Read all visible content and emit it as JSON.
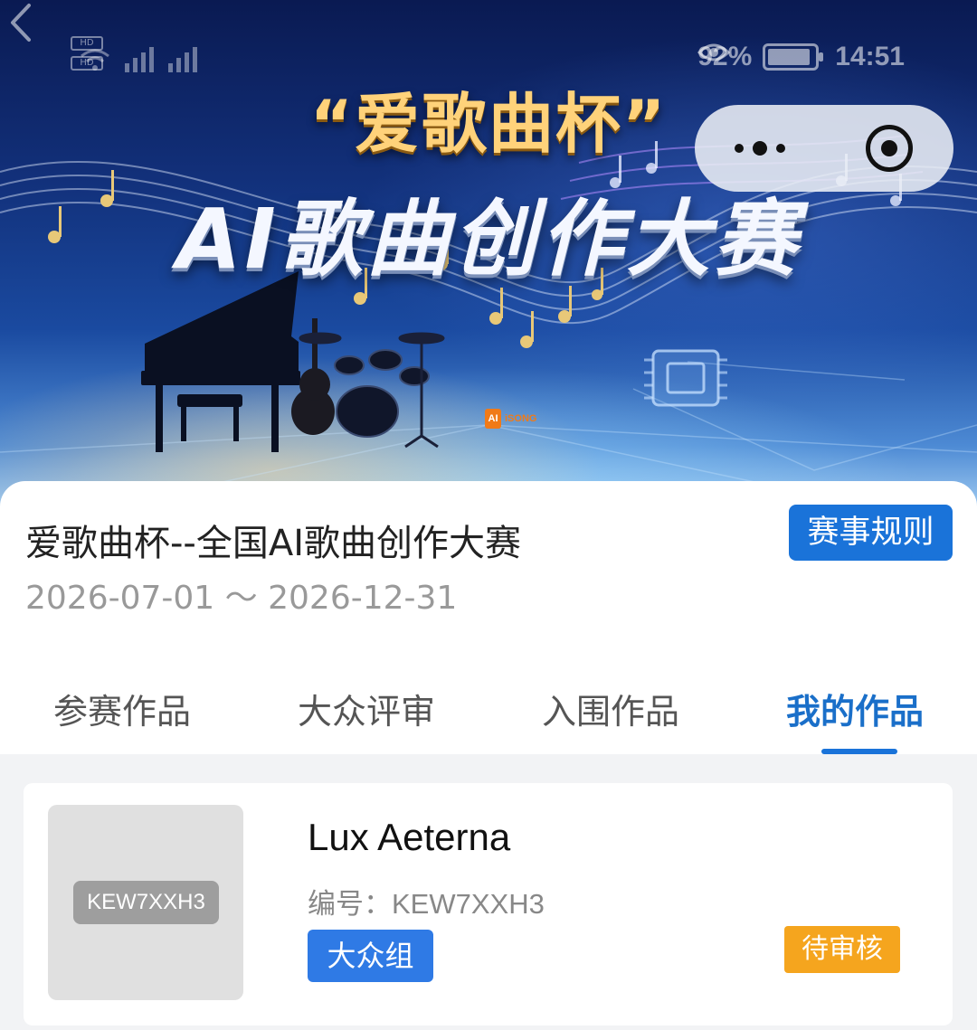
{
  "status_bar": {
    "sim_labels": [
      "HD",
      "HD"
    ],
    "battery": "92%",
    "time": "14:51"
  },
  "banner": {
    "title_line1": "“爱歌曲杯”",
    "title_line2": "AI歌曲创作大赛",
    "brand_mark": "AI",
    "brand_name": "iSONG"
  },
  "contest": {
    "title": "爱歌曲杯--全国AI歌曲创作大赛",
    "date_range": "2026-07-01 ～ 2026-12-31",
    "rules_button": "赛事规则"
  },
  "tabs": [
    {
      "label": "参赛作品",
      "active": false
    },
    {
      "label": "大众评审",
      "active": false
    },
    {
      "label": "入围作品",
      "active": false
    },
    {
      "label": "我的作品",
      "active": true
    }
  ],
  "works": [
    {
      "cover_tag": "KEW7XXH3",
      "title": "Lux Aeterna",
      "code_label": "编号：",
      "code_value": "KEW7XXH3",
      "group": "大众组",
      "status": "待审核"
    }
  ],
  "colors": {
    "accent": "#1a73d9",
    "group_badge": "#2f7ae5",
    "status_pending": "#f5a51e"
  }
}
